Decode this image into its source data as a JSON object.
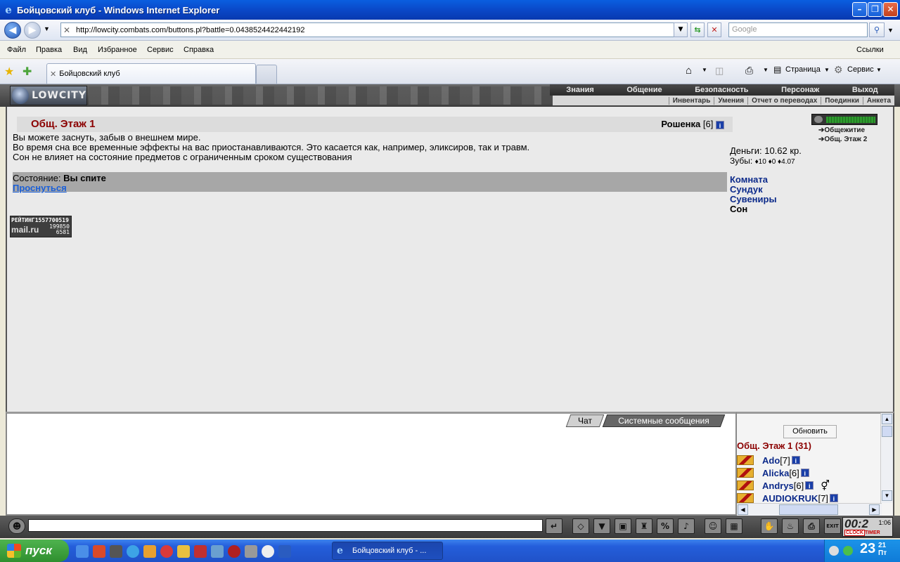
{
  "window": {
    "title": "Бойцовский клуб - Windows Internet Explorer"
  },
  "addressbar": {
    "url": "http://lowcity.combats.com/buttons.pl?battle=0.0438524422442192",
    "search_placeholder": "Google"
  },
  "menu": {
    "items": [
      "Файл",
      "Правка",
      "Вид",
      "Избранное",
      "Сервис",
      "Справка"
    ],
    "links": "Ссылки"
  },
  "tab": {
    "label": "Бойцовский клуб"
  },
  "toolbar": {
    "page": "Страница",
    "service": "Сервис"
  },
  "game": {
    "logo": "LOWCITY",
    "top_links": [
      "Знания",
      "Общение",
      "Безопасность",
      "Персонаж",
      "Выход"
    ],
    "sub_links": [
      "Инвентарь",
      "Умения",
      "Отчет о переводах",
      "Поединки",
      "Анкета"
    ],
    "room_title": "Общ. Этаж 1",
    "player": {
      "name": "Рошенка",
      "level": "[6]"
    },
    "description": [
      "Вы можете заснуть, забыв о внешнем мире.",
      "Во время сна все временные эффекты на вас приостанавливаются. Это касается как, например, эликсиров, так и травм.",
      "Сон не влияет на состояние предметов с ограниченным сроком существования"
    ],
    "state_label": "Состояние:",
    "state_value": "Вы спите",
    "wake_link": "Проснуться",
    "counter": {
      "label": "РЕЙТИНГ",
      "mail": "mail.ru",
      "n1": "1557700519",
      "n2": "199850",
      "n3": "6581"
    },
    "locations": [
      "Общежитие",
      "Общ. Этаж 2"
    ],
    "money": "Деньги: 10.62 кр.",
    "teeth": {
      "label": "Зубы:",
      "values": [
        "10",
        "0",
        "4.07"
      ]
    },
    "right_links": [
      "Комната",
      "Сундук",
      "Сувениры",
      "Сон"
    ],
    "chat_tabs": [
      "Чат",
      "Системные сообщения"
    ],
    "refresh_label": "Обновить",
    "room_count": "Общ. Этаж 1 (31)",
    "users": [
      {
        "name": "Ado",
        "level": "[7]"
      },
      {
        "name": "Alicka",
        "level": "[6]"
      },
      {
        "name": "Andrys",
        "level": "[6]"
      },
      {
        "name": "AUDIOKRUK",
        "level": "[7]"
      }
    ],
    "clock": {
      "time": "00:2",
      "sec": "1:06",
      "clock_label": "CLOCK",
      "timer_label": "TIMER"
    }
  },
  "taskbar": {
    "start": "пуск",
    "item": "Бойцовский клуб - ...",
    "time": "23",
    "time_min": "21",
    "day": "Пт"
  },
  "colors": {
    "room_title": "#8b0000",
    "link": "#0c2a8a",
    "wake": "#1a5fd8"
  }
}
